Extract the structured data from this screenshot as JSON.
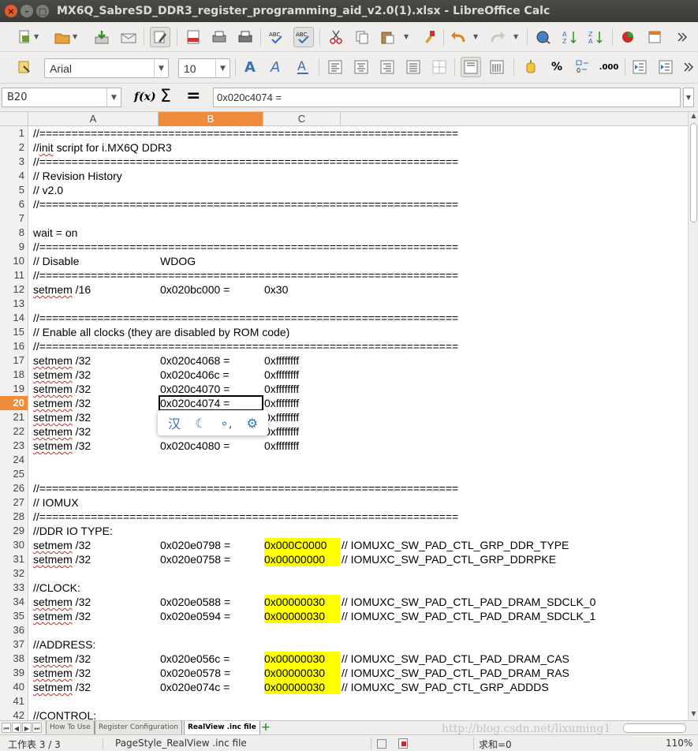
{
  "window": {
    "title": "MX6Q_SabreSD_DDR3_register_programming_aid_v2.0(1).xlsx - LibreOffice Calc"
  },
  "toolbar2": {
    "font_name": "Arial",
    "font_size": "10",
    "currency_label": "%",
    "decimal_label": ".000"
  },
  "formula_bar": {
    "name_box": "B20",
    "content": "0x020c4074 ="
  },
  "columns": [
    "A",
    "B",
    "C"
  ],
  "selected_cell": {
    "row": 20,
    "col": "B"
  },
  "rows": [
    {
      "n": "1",
      "a": "//=================================================================",
      "b": "",
      "c": "",
      "d": ""
    },
    {
      "n": "2",
      "a": "//init script for i.MX6Q DDR3",
      "b": "",
      "c": "",
      "d": ""
    },
    {
      "n": "3",
      "a": "//=================================================================",
      "b": "",
      "c": "",
      "d": ""
    },
    {
      "n": "4",
      "a": "// Revision History",
      "b": "",
      "c": "",
      "d": ""
    },
    {
      "n": "5",
      "a": "// v2.0",
      "b": "",
      "c": "",
      "d": ""
    },
    {
      "n": "6",
      "a": "//=================================================================",
      "b": "",
      "c": "",
      "d": ""
    },
    {
      "n": "7",
      "a": "",
      "b": "",
      "c": "",
      "d": ""
    },
    {
      "n": "8",
      "a": "wait = on",
      "b": "",
      "c": "",
      "d": ""
    },
    {
      "n": "9",
      "a": "//=================================================================",
      "b": "",
      "c": "",
      "d": ""
    },
    {
      "n": "10",
      "a": "// Disable",
      "b": "WDOG",
      "c": "",
      "d": ""
    },
    {
      "n": "11",
      "a": "//=================================================================",
      "b": "",
      "c": "",
      "d": ""
    },
    {
      "n": "12",
      "a": "setmem /16",
      "b": "0x020bc000 =",
      "c": "0x30",
      "d": ""
    },
    {
      "n": "13",
      "a": "",
      "b": "",
      "c": "",
      "d": ""
    },
    {
      "n": "14",
      "a": "//=================================================================",
      "b": "",
      "c": "",
      "d": ""
    },
    {
      "n": "15",
      "a": "// Enable all clocks (they are disabled by ROM code)",
      "b": "",
      "c": "",
      "d": ""
    },
    {
      "n": "16",
      "a": "//=================================================================",
      "b": "",
      "c": "",
      "d": ""
    },
    {
      "n": "17",
      "a": "setmem /32",
      "b": "0x020c4068 =",
      "c": "0xffffffff",
      "d": ""
    },
    {
      "n": "18",
      "a": "setmem /32",
      "b": "0x020c406c =",
      "c": "0xffffffff",
      "d": ""
    },
    {
      "n": "19",
      "a": "setmem /32",
      "b": "0x020c4070 =",
      "c": "0xffffffff",
      "d": ""
    },
    {
      "n": "20",
      "a": "setmem /32",
      "b": "0x020c4074 =",
      "c": "0xffffffff",
      "d": ""
    },
    {
      "n": "21",
      "a": "setmem /32",
      "b": "",
      "c": "0xffffffff",
      "d": ""
    },
    {
      "n": "22",
      "a": "setmem /32",
      "b": "",
      "c": "0xffffffff",
      "d": ""
    },
    {
      "n": "23",
      "a": "setmem /32",
      "b": "0x020c4080 =",
      "c": "0xffffffff",
      "d": ""
    },
    {
      "n": "24",
      "a": "",
      "b": "",
      "c": "",
      "d": ""
    },
    {
      "n": "25",
      "a": "",
      "b": "",
      "c": "",
      "d": ""
    },
    {
      "n": "26",
      "a": "//=================================================================",
      "b": "",
      "c": "",
      "d": ""
    },
    {
      "n": "27",
      "a": "// IOMUX",
      "b": "",
      "c": "",
      "d": ""
    },
    {
      "n": "28",
      "a": "//=================================================================",
      "b": "",
      "c": "",
      "d": ""
    },
    {
      "n": "29",
      "a": "//DDR IO TYPE:",
      "b": "",
      "c": "",
      "d": ""
    },
    {
      "n": "30",
      "a": "setmem /32",
      "b": "0x020e0798 =",
      "c": "0x000C0000",
      "d": "// IOMUXC_SW_PAD_CTL_GRP_DDR_TYPE"
    },
    {
      "n": "31",
      "a": "setmem /32",
      "b": "0x020e0758 =",
      "c": "0x00000000",
      "d": "// IOMUXC_SW_PAD_CTL_GRP_DDRPKE"
    },
    {
      "n": "32",
      "a": "",
      "b": "",
      "c": "",
      "d": ""
    },
    {
      "n": "33",
      "a": "//CLOCK:",
      "b": "",
      "c": "",
      "d": ""
    },
    {
      "n": "34",
      "a": "setmem /32",
      "b": "0x020e0588 =",
      "c": "0x00000030",
      "d": "// IOMUXC_SW_PAD_CTL_PAD_DRAM_SDCLK_0"
    },
    {
      "n": "35",
      "a": "setmem /32",
      "b": "0x020e0594 =",
      "c": "0x00000030",
      "d": "// IOMUXC_SW_PAD_CTL_PAD_DRAM_SDCLK_1"
    },
    {
      "n": "36",
      "a": "",
      "b": "",
      "c": "",
      "d": ""
    },
    {
      "n": "37",
      "a": "//ADDRESS:",
      "b": "",
      "c": "",
      "d": ""
    },
    {
      "n": "38",
      "a": "setmem /32",
      "b": "0x020e056c =",
      "c": "0x00000030",
      "d": "// IOMUXC_SW_PAD_CTL_PAD_DRAM_CAS"
    },
    {
      "n": "39",
      "a": "setmem /32",
      "b": "0x020e0578 =",
      "c": "0x00000030",
      "d": "// IOMUXC_SW_PAD_CTL_PAD_DRAM_RAS"
    },
    {
      "n": "40",
      "a": "setmem /32",
      "b": "0x020e074c =",
      "c": "0x00000030",
      "d": "// IOMUXC_SW_PAD_CTL_GRP_ADDDS"
    },
    {
      "n": "41",
      "a": "",
      "b": "",
      "c": "",
      "d": ""
    },
    {
      "n": "42",
      "a": "//CONTROL:",
      "b": "",
      "c": "",
      "d": ""
    }
  ],
  "highlight_color": "#ffff00",
  "selection_color": "#f08b3a",
  "sheet_tabs": [
    {
      "label": "How To Use",
      "active": false
    },
    {
      "label": "Register Configuration",
      "active": false
    },
    {
      "label": "RealView .inc file",
      "active": true
    }
  ],
  "status_bar": {
    "sheet": "工作表 3 / 3",
    "page_style": "PageStyle_RealView .inc file",
    "sum": "求和=0",
    "zoom": "110%"
  },
  "watermark": "http://blog.csdn.net/lixuming1"
}
